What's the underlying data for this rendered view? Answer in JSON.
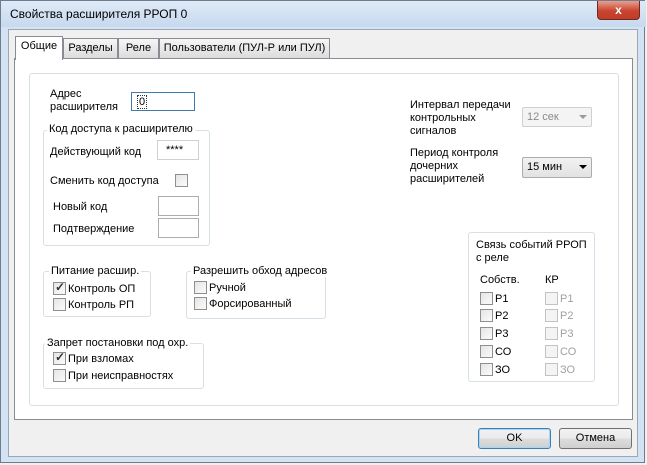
{
  "window": {
    "title": "Свойства расширителя РРОП 0",
    "close_label": "x"
  },
  "tabs": [
    {
      "label": "Общие",
      "active": true
    },
    {
      "label": "Разделы"
    },
    {
      "label": "Реле"
    },
    {
      "label": "Пользователи (ПУЛ-Р или ПУЛ)"
    }
  ],
  "address": {
    "label_line1": "Адрес",
    "label_line2": "расширителя",
    "value": "0"
  },
  "access": {
    "group_title": "Код доступа к расширителю",
    "current_label": "Действующий код",
    "current_value": "****",
    "change_label": "Сменить код доступа",
    "new_label": "Новый код",
    "confirm_label": "Подтверждение"
  },
  "power": {
    "group_title": "Питание расшир.",
    "items": [
      {
        "label": "Контроль ОП",
        "checked": true
      },
      {
        "label": "Контроль РП",
        "checked": false
      }
    ]
  },
  "bypass": {
    "group_title": "Разрешить обход адресов",
    "items": [
      {
        "label": "Ручной",
        "checked": false
      },
      {
        "label": "Форсированный",
        "checked": false
      }
    ]
  },
  "arming": {
    "group_title": "Запрет постановки под охр.",
    "items": [
      {
        "label": "При взломах",
        "checked": true
      },
      {
        "label": "При неисправностях",
        "checked": false
      }
    ]
  },
  "interval": {
    "label_lines": [
      "Интервал передачи",
      "контрольных",
      "сигналов"
    ],
    "value": "12 сек",
    "disabled": true
  },
  "period": {
    "label_lines": [
      "Период контроля",
      "дочерних",
      "расширителей"
    ],
    "value": "15 мин"
  },
  "relay_link": {
    "title_line1": "Связь событий РРОП",
    "title_line2": "с реле",
    "col1": "Собств.",
    "col2": "КР",
    "rows": [
      "Р1",
      "Р2",
      "Р3",
      "СО",
      "ЗО"
    ]
  },
  "buttons": {
    "ok": "OK",
    "cancel": "Отмена"
  },
  "colors": {
    "accent": "#3c7fb1",
    "close": "#c8452f"
  }
}
